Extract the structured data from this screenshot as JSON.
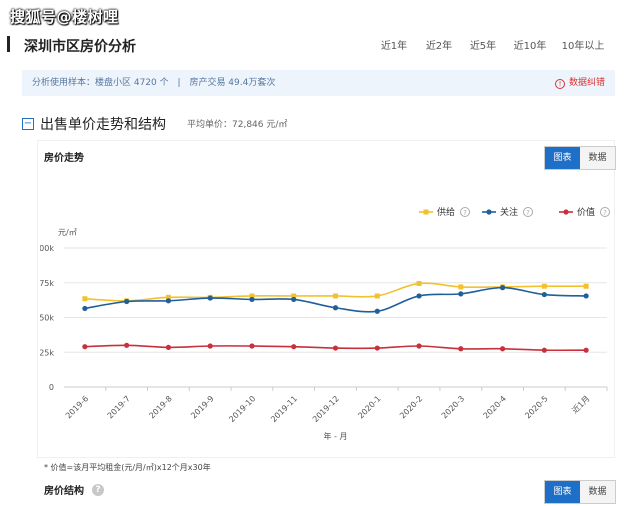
{
  "watermark": "搜狐号@楼树哩",
  "header": {
    "title": "深圳市区房价分析"
  },
  "range_tabs": [
    {
      "label": "近1年",
      "active": true
    },
    {
      "label": "近2年",
      "active": false
    },
    {
      "label": "近5年",
      "active": false
    },
    {
      "label": "近10年",
      "active": false
    },
    {
      "label": "10年以上",
      "active": false
    }
  ],
  "info": {
    "sample": "分析使用样本：楼盘小区 4720 个",
    "separator": "|",
    "trades": "房产交易 49.4万套次",
    "error_icon": "exclamation-icon",
    "error_label": "数据纠错"
  },
  "section": {
    "collapse_icon": "minus-square-icon",
    "collapse_symbol": "−",
    "title": "出售单价走势和结构",
    "avg_label": "平均单价：72,846 元/㎡"
  },
  "trend": {
    "title": "房价走势",
    "toggle": {
      "chart_label": "图表",
      "data_label": "数据"
    }
  },
  "structure": {
    "title": "房价结构",
    "help_icon": "question-circle-icon",
    "help_symbol": "?",
    "toggle": {
      "chart_label": "图表",
      "data_label": "数据"
    }
  },
  "note": "* 价值=该月平均租金(元/月/㎡)x12个月x30年",
  "colors": {
    "accent": "#1e6fc8",
    "supply": "#f2c12e",
    "focus": "#1f5f9b",
    "value": "#c8303b"
  },
  "chart_data": {
    "type": "line",
    "categories": [
      "2019-6",
      "2019-7",
      "2019-8",
      "2019-9",
      "2019-10",
      "2019-11",
      "2019-12",
      "2020-1",
      "2020-2",
      "2020-3",
      "2020-4",
      "2020-5",
      "近1月"
    ],
    "xlabel": "年 - 月",
    "ylabel": "元/㎡",
    "ylim": [
      0,
      100000
    ],
    "yticks": [
      0,
      25000,
      50000,
      75000,
      100000
    ],
    "ytick_labels": [
      "0",
      "25k",
      "50k",
      "75k",
      "100k"
    ],
    "grid": true,
    "legend_position": "top-right",
    "series": [
      {
        "name": "供给",
        "color": "#f2c12e",
        "marker": "square",
        "values": [
          63500,
          62000,
          64500,
          64500,
          65500,
          65500,
          65500,
          65500,
          74500,
          72000,
          72000,
          72500,
          72500
        ]
      },
      {
        "name": "关注",
        "color": "#1f5f9b",
        "marker": "circle",
        "values": [
          56500,
          61500,
          62000,
          64000,
          63000,
          63000,
          57000,
          54500,
          65500,
          67000,
          71500,
          66500,
          65500
        ]
      },
      {
        "name": "价值",
        "color": "#c8303b",
        "marker": "circle",
        "values": [
          29000,
          30000,
          28500,
          29500,
          29500,
          29000,
          28000,
          28000,
          29500,
          27500,
          27500,
          26500,
          26500
        ]
      }
    ]
  }
}
